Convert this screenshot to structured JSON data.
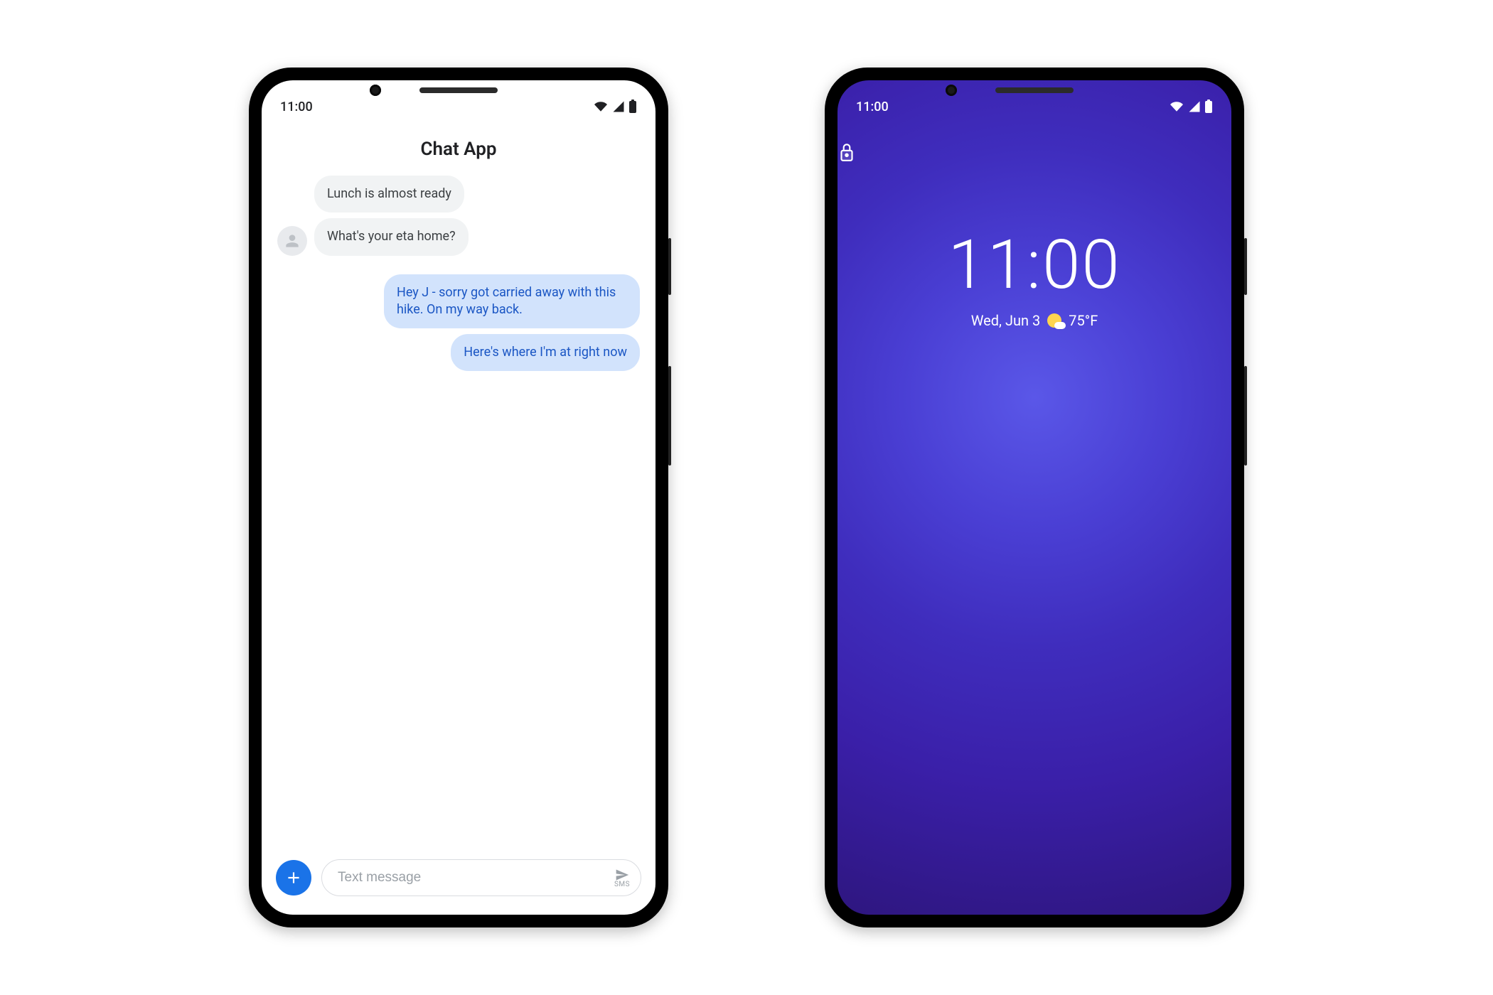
{
  "left": {
    "status_time": "11:00",
    "app_title": "Chat App",
    "messages": {
      "m1": "Lunch is almost ready",
      "m2": "What's your eta home?",
      "m3": "Hey J - sorry got carried away with this hike. On my way back.",
      "m4": "Here's where I'm at right now"
    },
    "composer": {
      "placeholder": "Text message",
      "send_sublabel": "SMS"
    }
  },
  "right": {
    "status_time": "11:00",
    "clock": "11:00",
    "date": "Wed, Jun 3",
    "temperature": "75°F"
  }
}
